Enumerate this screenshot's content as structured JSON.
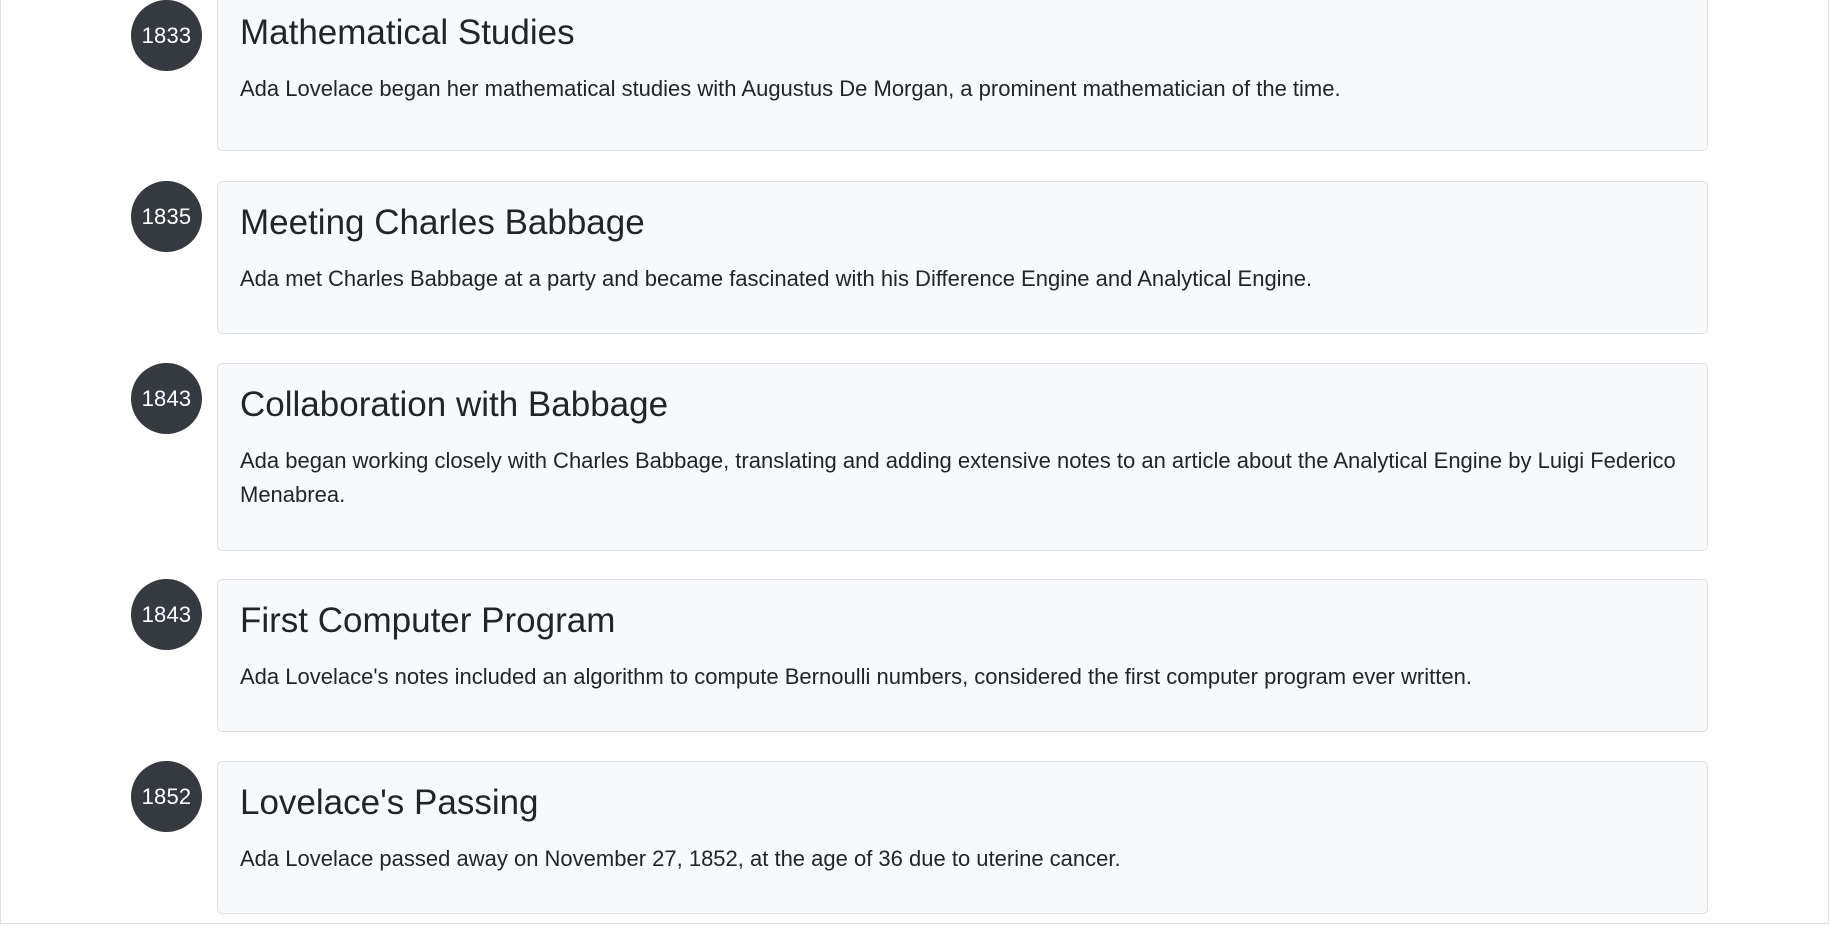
{
  "timeline": {
    "events": [
      {
        "year": "1833",
        "title": "Mathematical Studies",
        "description": "Ada Lovelace began her mathematical studies with Augustus De Morgan, a prominent mathematician of the time."
      },
      {
        "year": "1835",
        "title": "Meeting Charles Babbage",
        "description": "Ada met Charles Babbage at a party and became fascinated with his Difference Engine and Analytical Engine."
      },
      {
        "year": "1843",
        "title": "Collaboration with Babbage",
        "description": "Ada began working closely with Charles Babbage, translating and adding extensive notes to an article about the Analytical Engine by Luigi Federico Menabrea."
      },
      {
        "year": "1843",
        "title": "First Computer Program",
        "description": "Ada Lovelace's notes included an algorithm to compute Bernoulli numbers, considered the first computer program ever written."
      },
      {
        "year": "1852",
        "title": "Lovelace's Passing",
        "description": "Ada Lovelace passed away on November 27, 1852, at the age of 36 due to uterine cancer."
      }
    ]
  }
}
